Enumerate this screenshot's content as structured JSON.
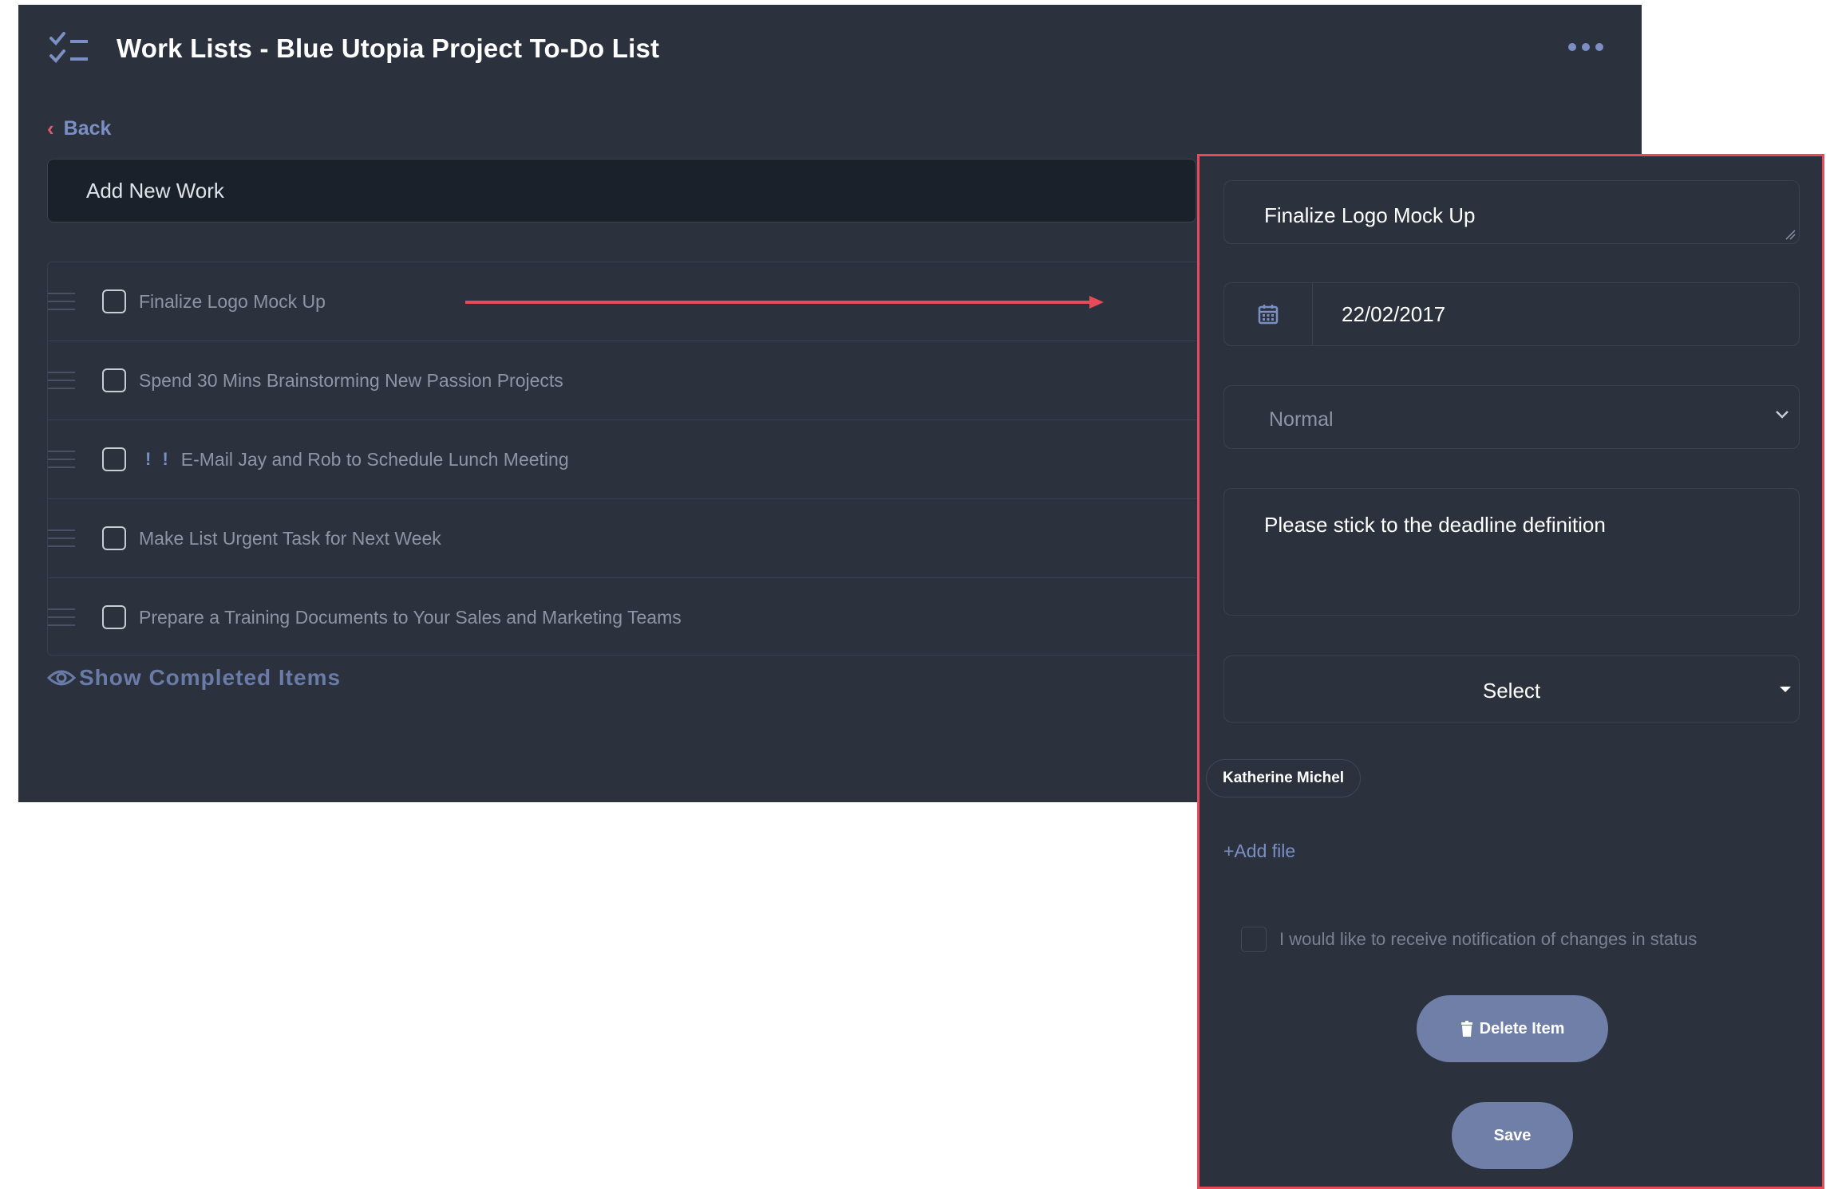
{
  "header": {
    "title": "Work Lists - Blue Utopia Project To-Do List",
    "icon": "checklist-icon",
    "more_icon": "ellipsis-icon"
  },
  "nav": {
    "back_label": "Back"
  },
  "new_work": {
    "value": "Add New Work"
  },
  "tasks": [
    {
      "label": "Finalize Logo Mock Up",
      "checked": false
    },
    {
      "label": "Spend 30 Mins Brainstorming New Passion Projects",
      "checked": false
    },
    {
      "label": "E-Mail Jay and Rob to Schedule Lunch Meeting",
      "checked": false,
      "priority": "! !"
    },
    {
      "label": "Make List Urgent Task for Next Week",
      "checked": false
    },
    {
      "label": "Prepare a Training Documents to Your Sales and Marketing Teams",
      "checked": false
    }
  ],
  "show_completed": {
    "label": "Show Completed Items",
    "icon": "eye-icon"
  },
  "editor": {
    "title": "Finalize Logo Mock Up",
    "date": "22/02/2017",
    "priority": "Normal",
    "note": "Please stick to the deadline definition",
    "assignee_placeholder": "Select",
    "assignee_chip": "Katherine Michel",
    "add_file": "+Add file",
    "notify_label": "I would like to receive notification of changes in status",
    "notify_checked": false,
    "delete_label": "Delete Item",
    "save_label": "Save"
  },
  "colors": {
    "panel_bg": "#2b323d",
    "accent": "#7c8fc4",
    "highlight_border": "#e84a57",
    "button_bg": "#6f7fa8"
  }
}
